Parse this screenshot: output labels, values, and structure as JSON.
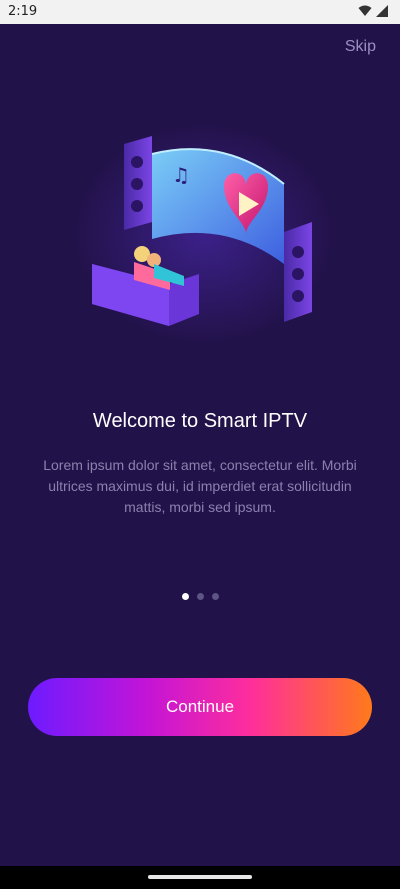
{
  "status_bar": {
    "time": "2:19",
    "icons": [
      "wifi-icon",
      "signal-icon"
    ]
  },
  "onboarding": {
    "skip_label": "Skip",
    "title": "Welcome to Smart IPTV",
    "description": "Lorem ipsum dolor sit amet, consectetur elit. Morbi ultrices maximus dui, id imperdiet erat sollicitudin mattis, morbi sed ipsum.",
    "pagination": {
      "total": 3,
      "active": 1
    },
    "continue_label": "Continue"
  },
  "colors": {
    "background": "#22124a",
    "text_primary": "#ffffff",
    "text_secondary": "#8a81ad",
    "gradient_start": "#6d1bff",
    "gradient_mid": "#ff2e9b",
    "gradient_end": "#ff7a1a"
  }
}
